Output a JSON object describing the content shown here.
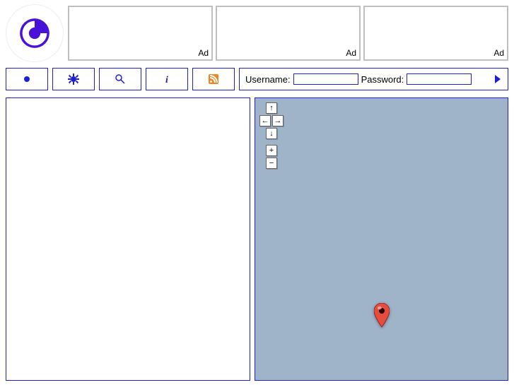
{
  "ads": {
    "label": "Ad"
  },
  "login": {
    "username_label": "Username:",
    "password_label": "Password:"
  },
  "map_controls": {
    "up": "↑",
    "down": "↓",
    "left": "←",
    "right": "→",
    "zoom_in": "+",
    "zoom_out": "−"
  }
}
